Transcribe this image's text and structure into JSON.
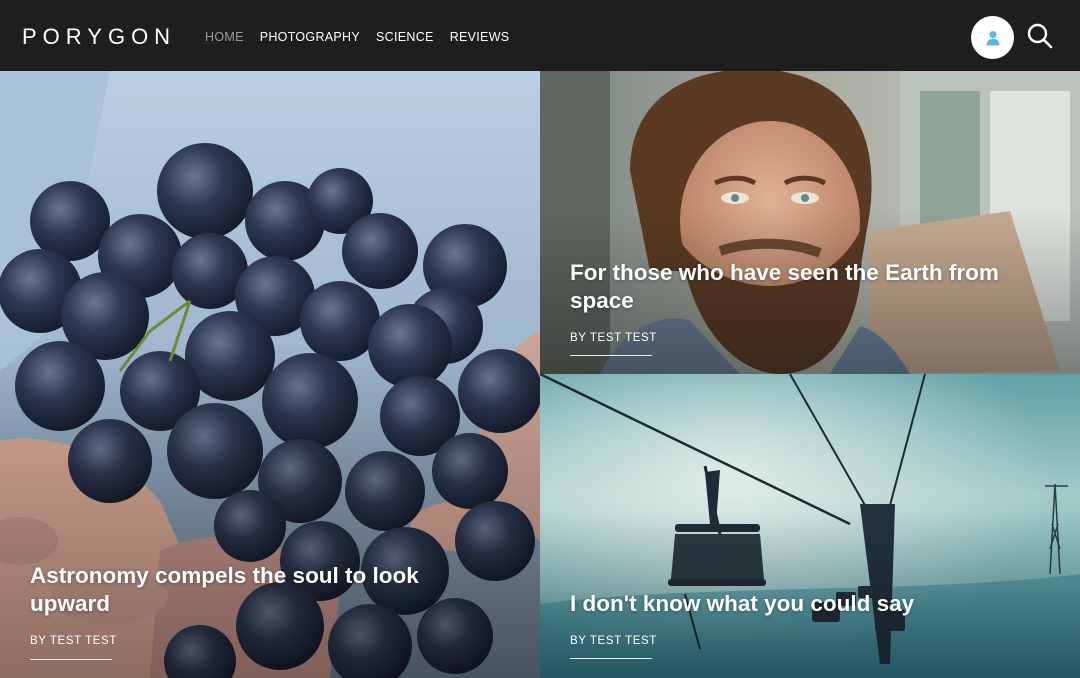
{
  "brand": {
    "logo_text": "PORYGON"
  },
  "nav": {
    "items": [
      {
        "label": "HOME",
        "active": true
      },
      {
        "label": "PHOTOGRAPHY",
        "active": false
      },
      {
        "label": "SCIENCE",
        "active": false
      },
      {
        "label": "REVIEWS",
        "active": false
      }
    ]
  },
  "header_actions": {
    "account_icon": "user-icon",
    "search_icon": "search-icon"
  },
  "posts": [
    {
      "title": "Astronomy compels the soul to look upward",
      "byline": "BY TEST TEST",
      "image": "grapes-in-hands"
    },
    {
      "title": "For those who have seen the Earth from space",
      "byline": "BY TEST TEST",
      "image": "bearded-man-portrait"
    },
    {
      "title": "I don't know what you could say",
      "byline": "BY TEST TEST",
      "image": "ski-lift-in-fog"
    }
  ],
  "colors": {
    "header_bg": "#1e1e1e",
    "nav_active": "#9a9a9a",
    "accent_icon": "#5bb7e6"
  }
}
